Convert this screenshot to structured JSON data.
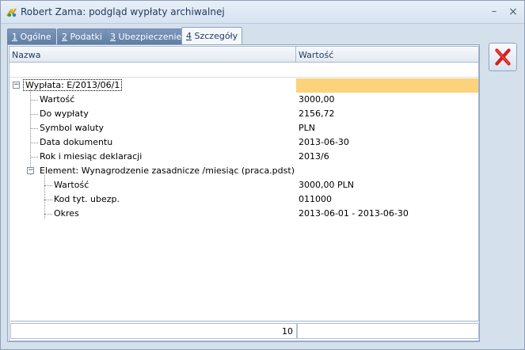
{
  "window": {
    "title": "Robert Zama: podgląd wypłaty archiwalnej",
    "minimize_glyph": "–",
    "close_glyph": "×"
  },
  "tabs": [
    {
      "key": "1",
      "label": "Ogólne",
      "active": false
    },
    {
      "key": "2",
      "label": "Podatki",
      "active": false
    },
    {
      "key": "3",
      "label": "Ubezpieczenie",
      "active": false
    },
    {
      "key": "4",
      "label": "Szczegóły",
      "active": true
    }
  ],
  "grid": {
    "columns": [
      "Nazwa",
      "Wartość"
    ],
    "rows": [
      {
        "name": "Wypłata: E/2013/06/1",
        "value": "",
        "level": 0,
        "expander": "−",
        "selected": true
      },
      {
        "name": "Wartość",
        "value": "3000,00",
        "level": 1
      },
      {
        "name": "Do wypłaty",
        "value": "2156,72",
        "level": 1
      },
      {
        "name": "Symbol waluty",
        "value": "PLN",
        "level": 1
      },
      {
        "name": "Data dokumentu",
        "value": "2013-06-30",
        "level": 1
      },
      {
        "name": "Rok i miesiąc deklaracji",
        "value": "2013/6",
        "level": 1
      },
      {
        "name": "Element: Wynagrodzenie zasadnicze /miesiąc (praca.pdst)",
        "value": "",
        "level": 1,
        "expander": "−"
      },
      {
        "name": "Wartość",
        "value": "3000,00 PLN",
        "level": 2
      },
      {
        "name": "Kod tyt. ubezp.",
        "value": "011000",
        "level": 2
      },
      {
        "name": "Okres",
        "value": "2013-06-01 - 2013-06-30",
        "level": 2
      }
    ],
    "footer_count": "10"
  },
  "icons": {
    "title": "app-logo-icon",
    "close_action": "red-x-icon"
  },
  "colors": {
    "selection": "#fbd37d",
    "tab_inactive": "#6f8bb0",
    "close_x": "#d41f1f"
  }
}
